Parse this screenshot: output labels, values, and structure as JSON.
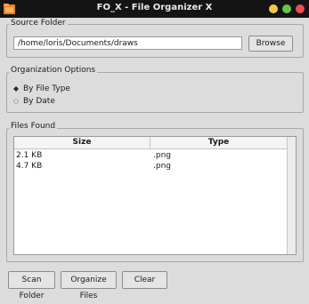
{
  "window": {
    "title": "FO_X - File Organizer X"
  },
  "source": {
    "title": "Source Folder",
    "path": "/home/loris/Documents/draws",
    "browse": "Browse"
  },
  "options": {
    "title": "Organization Options",
    "items": [
      {
        "label": "By File Type",
        "selected": true
      },
      {
        "label": "By Date",
        "selected": false
      }
    ]
  },
  "files": {
    "title": "Files Found",
    "columns": [
      "Size",
      "Type"
    ],
    "rows": [
      {
        "size": "2.1 KB",
        "type": ".png"
      },
      {
        "size": "4.7 KB",
        "type": ".png"
      }
    ]
  },
  "actions": {
    "scan": "Scan Folder",
    "organize": "Organize Files",
    "clear": "Clear"
  },
  "colors": {
    "titlebar": "#141414",
    "min": "#f2c84b",
    "max": "#66c545",
    "close": "#ef4d51"
  }
}
